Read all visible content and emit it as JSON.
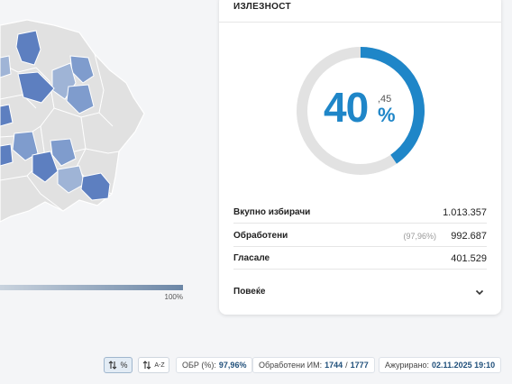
{
  "map": {
    "scale_max_label": "100%",
    "colors": {
      "base": "#e1e1e1",
      "border": "#ffffff",
      "light": "#9fb4d6",
      "mid": "#7f9ccd",
      "dark": "#5d7fc0"
    }
  },
  "turnout": {
    "title": "ИЗЛЕЗНОСТ",
    "percent_fraction": 0.4045,
    "percent_integer": "40",
    "percent_decimal": ",45",
    "percent_sign": "%",
    "ring_color": "#1f86c8",
    "ring_track_color": "#e2e2e2",
    "rows": [
      {
        "label": "Вкупно избирачи",
        "value": "1.013.357",
        "sub": ""
      },
      {
        "label": "Обработени",
        "value": "992.687",
        "sub": "(97,96%)"
      },
      {
        "label": "Гласале",
        "value": "401.529",
        "sub": ""
      }
    ],
    "more_label": "Повеќе"
  },
  "footer": {
    "sort_percent_label": "%",
    "sort_alpha_label": "A-Z",
    "obr_label": "ОБР (%):",
    "obr_value": "97,96%",
    "processed_label": "Обработени ИМ:",
    "processed_value": "1744",
    "processed_total": "1777",
    "updated_label": "Ажурирано:",
    "updated_value": "02.11.2025 19:10"
  }
}
